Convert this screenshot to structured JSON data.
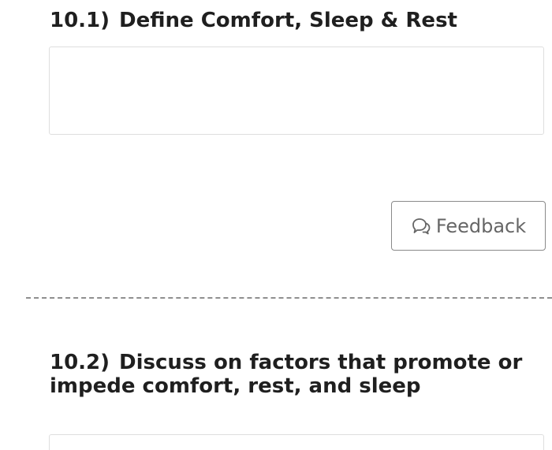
{
  "questions": [
    {
      "number": "10.1)",
      "text": "Define Comfort, Sleep & Rest",
      "answer": ""
    },
    {
      "number": "10.2)",
      "text": "Discuss on factors that promote or impede comfort, rest, and sleep",
      "answer": ""
    }
  ],
  "feedback": {
    "label": "Feedback",
    "icon": "speech-bubbles-icon"
  },
  "colors": {
    "text": "#1f1f1f",
    "button_border": "#8a8a8a",
    "button_text": "#666666",
    "input_border": "#dedede",
    "divider": "#8f8f8f"
  }
}
